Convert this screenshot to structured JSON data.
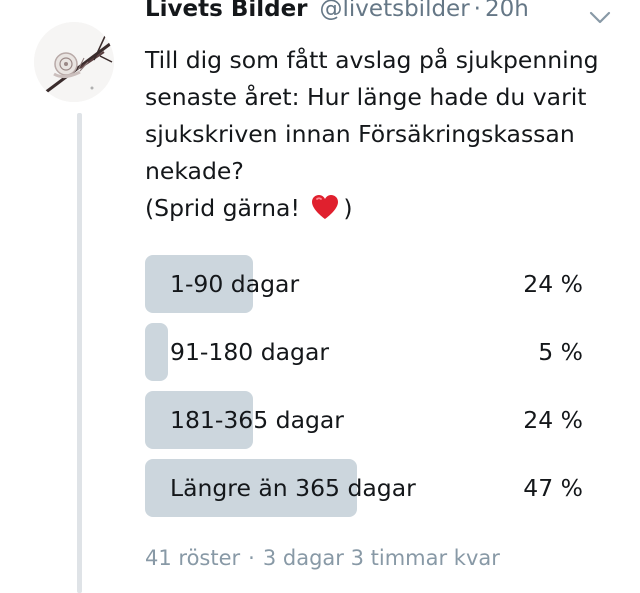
{
  "author": {
    "display_name": "Livets Bilder",
    "handle": "@livetsbilder",
    "separator": "·",
    "time": "20h"
  },
  "tweet": {
    "text_main": "Till dig som fått avslag på sjukpenning senaste året: Hur länge hade du varit sjukskriven innan Försäkringskassan nekade?",
    "text_paren_open": "(Sprid gärna!",
    "text_paren_close": ")",
    "emoji": "red-heart"
  },
  "poll": {
    "options": [
      {
        "label": "1-90 dagar",
        "percent_text": "24 %",
        "share": 0.24
      },
      {
        "label": "91-180 dagar",
        "percent_text": "5 %",
        "share": 0.05
      },
      {
        "label": "181-365 dagar",
        "percent_text": "24 %",
        "share": 0.24
      },
      {
        "label": "Längre än 365 dagar",
        "percent_text": "47 %",
        "share": 0.47
      }
    ],
    "votes": "41 röster",
    "separator": "·",
    "time_left": "3 dagar 3 timmar kvar"
  },
  "colors": {
    "poll_bar": "#ccd6dd",
    "secondary_text": "#657786",
    "meta_text": "#8899a6",
    "thread_line": "#dfe3e7",
    "heart": "#e0202e"
  },
  "icons": {
    "caret": "chevron-down-icon",
    "emoji": "heart-icon"
  }
}
